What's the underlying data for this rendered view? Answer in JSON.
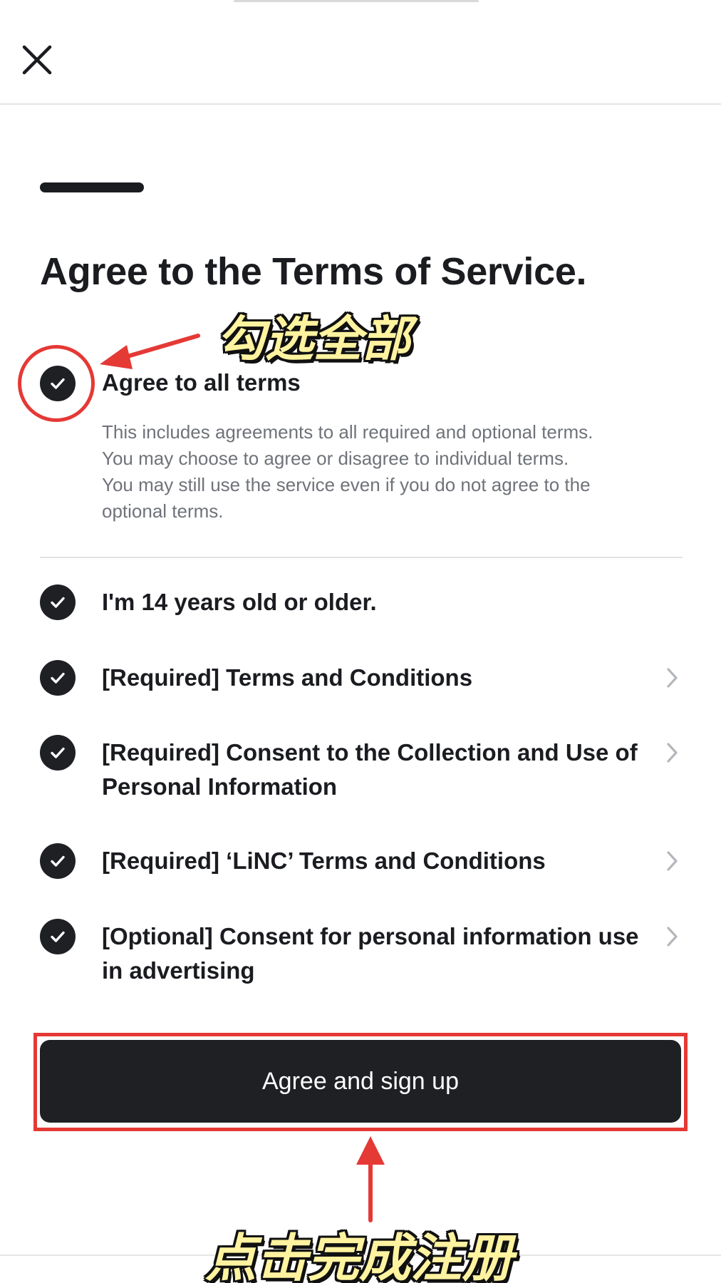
{
  "page": {
    "title": "Agree to the Terms of Service.",
    "progress": 1.0
  },
  "agree_all": {
    "label": "Agree to all terms",
    "checked": true,
    "description_lines": [
      "This includes agreements to all required and optional terms.",
      "You may choose to agree or disagree to individual terms.",
      "You may still use the service even if you do not agree to the optional terms."
    ]
  },
  "terms": [
    {
      "label": "I'm 14 years old or older.",
      "checked": true,
      "has_detail": false
    },
    {
      "label": "[Required] Terms and Conditions",
      "checked": true,
      "has_detail": true
    },
    {
      "label": "[Required] Consent to the Collection and Use of Personal Information",
      "checked": true,
      "has_detail": true
    },
    {
      "label": "[Required] ‘LiNC’ Terms and Conditions",
      "checked": true,
      "has_detail": true
    },
    {
      "label": "[Optional] Consent for personal information use in advertising",
      "checked": true,
      "has_detail": true
    }
  ],
  "submit": {
    "label": "Agree and sign up"
  },
  "annotations": {
    "select_all": "勾选全部",
    "tap_to_finish": "点击完成注册",
    "color": "#e53935"
  },
  "colors": {
    "primary": "#1f2024",
    "text": "#1a1c20",
    "muted": "#6f7379",
    "chevron": "#b4b7bb"
  },
  "icons": {
    "close": "close-icon",
    "check": "check-circle-icon",
    "chevron": "chevron-right-icon"
  }
}
